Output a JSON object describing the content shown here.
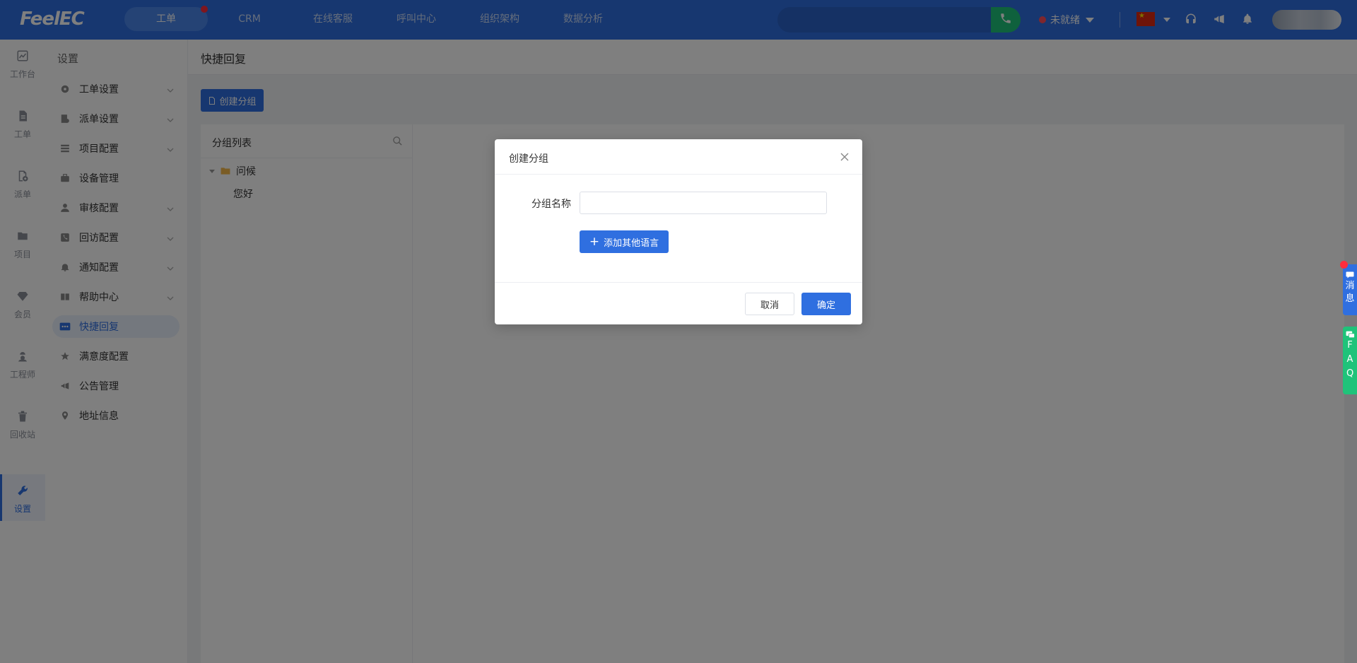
{
  "app": {
    "logo": "FeelEC"
  },
  "topnav": [
    {
      "label": "工单",
      "active": true,
      "has_badge": true
    },
    {
      "label": "CRM"
    },
    {
      "label": "在线客服"
    },
    {
      "label": "呼叫中心"
    },
    {
      "label": "组织架构"
    },
    {
      "label": "数据分析"
    }
  ],
  "header": {
    "search_placeholder": "",
    "status_label": "未就绪",
    "icons": [
      "china-flag-icon",
      "headset-icon",
      "megaphone-icon",
      "bell-icon",
      "avatar"
    ]
  },
  "rail": [
    {
      "label": "工作台",
      "icon": "chart-icon"
    },
    {
      "label": "工单",
      "icon": "document-icon"
    },
    {
      "label": "派单",
      "icon": "dispatch-icon"
    },
    {
      "label": "项目",
      "icon": "folder-icon"
    },
    {
      "label": "会员",
      "icon": "diamond-icon"
    },
    {
      "label": "工程师",
      "icon": "engineer-icon"
    },
    {
      "label": "回收站",
      "icon": "trash-icon"
    },
    {
      "label": "设置",
      "icon": "wrench-icon",
      "active": true
    }
  ],
  "settings_menu": {
    "title": "设置",
    "items": [
      {
        "label": "工单设置",
        "icon": "gear-icon",
        "expandable": true
      },
      {
        "label": "派单设置",
        "icon": "dispatch-settings-icon",
        "expandable": true
      },
      {
        "label": "项目配置",
        "icon": "list-icon",
        "expandable": true
      },
      {
        "label": "设备管理",
        "icon": "briefcase-icon"
      },
      {
        "label": "审核配置",
        "icon": "user-icon",
        "expandable": true
      },
      {
        "label": "回访配置",
        "icon": "phone-icon",
        "expandable": true
      },
      {
        "label": "通知配置",
        "icon": "bell-icon",
        "expandable": true
      },
      {
        "label": "帮助中心",
        "icon": "book-icon",
        "expandable": true
      },
      {
        "label": "快捷回复",
        "icon": "chat-dots-icon",
        "active": true
      },
      {
        "label": "满意度配置",
        "icon": "star-icon"
      },
      {
        "label": "公告管理",
        "icon": "megaphone-icon"
      },
      {
        "label": "地址信息",
        "icon": "location-icon"
      }
    ]
  },
  "main": {
    "page_title": "快捷回复",
    "create_group_label": "创建分组",
    "group_list": {
      "title": "分组列表",
      "tree": [
        {
          "label": "问候",
          "children": [
            "您好"
          ]
        }
      ]
    }
  },
  "floating": {
    "message_label": "消息",
    "faq_label": "FAQ"
  },
  "modal": {
    "title": "创建分组",
    "field_label": "分组名称",
    "field_value": "",
    "field_placeholder": "",
    "add_language_label": "添加其他语言",
    "cancel_label": "取消",
    "confirm_label": "确定"
  },
  "colors": {
    "primary": "#2f6fe0",
    "success": "#1fc37a",
    "danger": "#ff2d3c"
  }
}
